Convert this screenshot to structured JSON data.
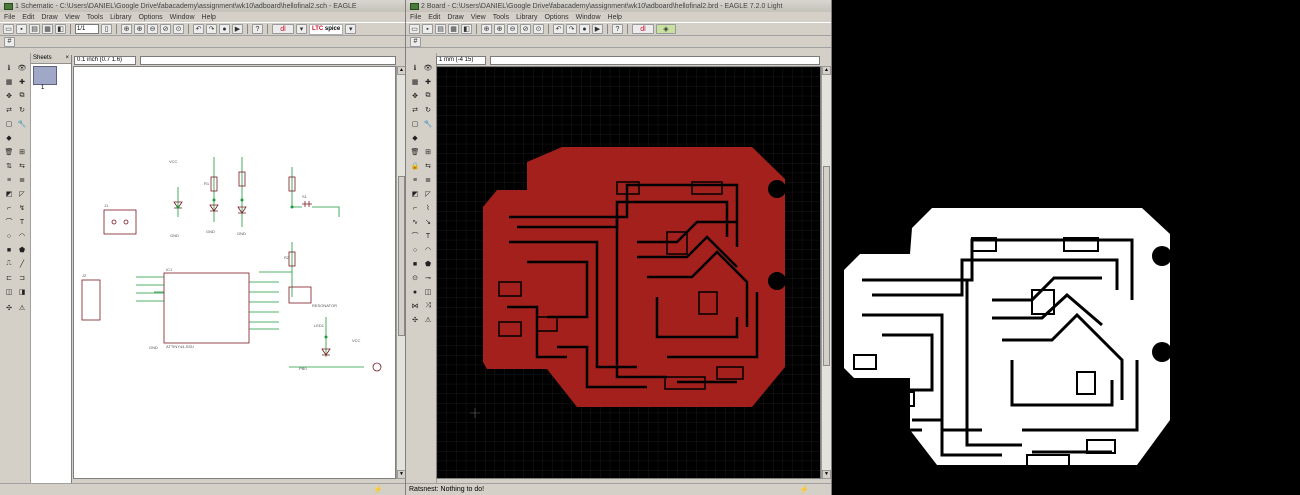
{
  "schematic_window": {
    "title": "1 Schematic - C:\\Users\\DANIEL\\Google Drive\\fabacademy\\assignment\\wk10\\adboard\\hellofinal2.sch - EAGLE",
    "menu": [
      "File",
      "Edit",
      "Draw",
      "View",
      "Tools",
      "Library",
      "Options",
      "Window",
      "Help"
    ],
    "zoom_value": "1/1",
    "brand_ltc": "LTC",
    "brand_spice": "spice",
    "sheets_label": "Sheets",
    "sheet_number": "1",
    "coordinate": "0.1 inch (0.7 1.6)",
    "status": ""
  },
  "board_window": {
    "title": "2 Board - C:\\Users\\DANIEL\\Google Drive\\fabacademy\\assignment\\wk10\\adboard\\hellofinal2.brd - EAGLE 7.2.0 Light",
    "menu": [
      "File",
      "Edit",
      "Draw",
      "View",
      "Tools",
      "Library",
      "Options",
      "Window",
      "Help"
    ],
    "coordinate": "1 mm (-4 15)",
    "status": "Ratsnest: Nothing to do!"
  },
  "schematic_labels": {
    "ic_name": "IC1",
    "ic_part": "ATTINY44-SSU",
    "gnd": "GND",
    "vcc": "VCC",
    "j1": "J1",
    "j2": "J2",
    "r1": "R1",
    "r2": "R2",
    "s1": "S1",
    "led": "LED1",
    "resonator": "RESONATOR",
    "pb0": "PB0"
  },
  "colors": {
    "board_copper": "#a3201d",
    "board_background": "#000000",
    "schematic_wire": "#1a9a3a",
    "schematic_part": "#7a1a22",
    "mask_white": "#ffffff"
  }
}
